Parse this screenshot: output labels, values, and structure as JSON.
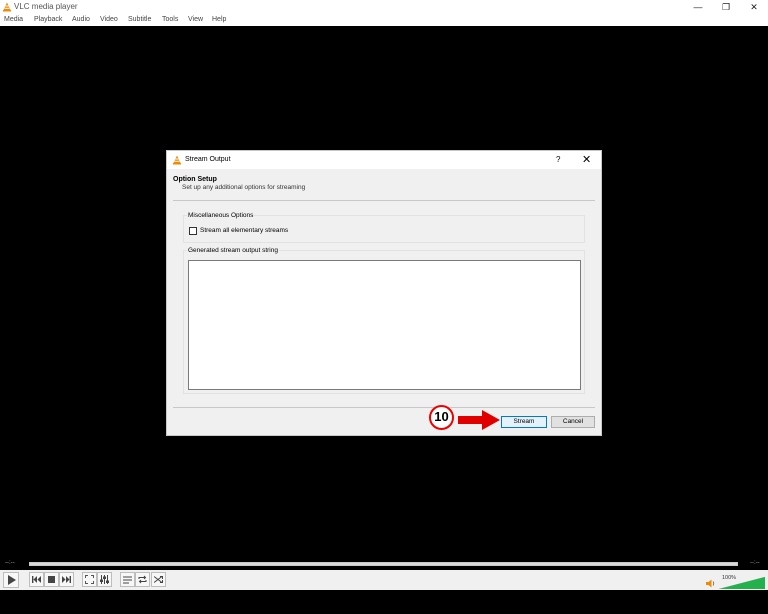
{
  "window": {
    "title": "VLC media player",
    "min_glyph": "—",
    "max_glyph": "❐",
    "close_glyph": "✕"
  },
  "menu": [
    "Media",
    "Playback",
    "Audio",
    "Video",
    "Subtitle",
    "Tools",
    "View",
    "Help"
  ],
  "dialog": {
    "title": "Stream Output",
    "help_glyph": "?",
    "close_glyph": "✕",
    "section_title": "Option Setup",
    "section_subtitle": "Set up any additional options for streaming",
    "misc_group_label": "Miscellaneous Options",
    "checkbox_label": "Stream all elementary streams",
    "checkbox_checked": false,
    "output_group_label": "Generated stream output string",
    "output_value": "",
    "stream_button": "Stream",
    "cancel_button": "Cancel"
  },
  "annotation": {
    "step_number": "10",
    "color": "#e00000"
  },
  "player": {
    "time_elapsed": "--:--",
    "time_remaining": "--:--",
    "volume": "100%",
    "volume_level": 1.0
  },
  "colors": {
    "vlc_orange": "#f08a00",
    "accent_blue": "#0078d7",
    "volume_green": "#22b14c"
  }
}
